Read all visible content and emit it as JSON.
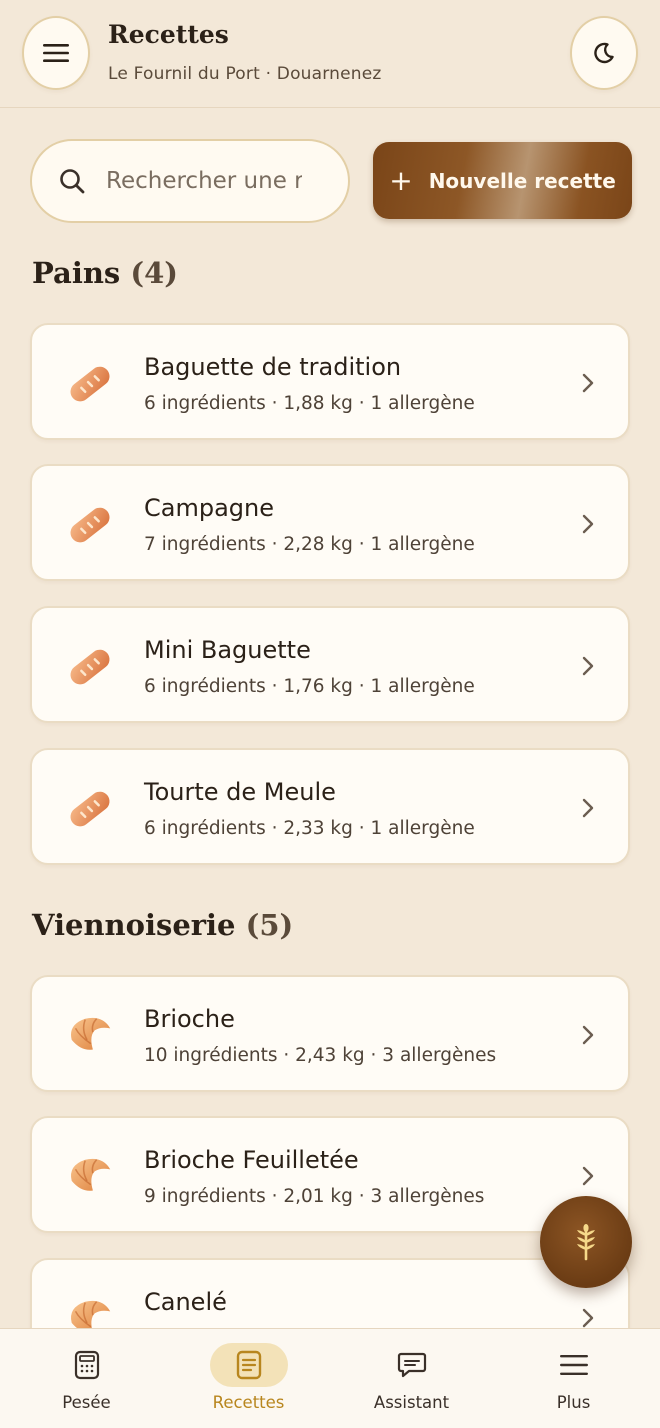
{
  "header": {
    "title": "Recettes",
    "subtitle": "Le Fournil du Port · Douarnenez"
  },
  "search": {
    "placeholder": "Rechercher une recette",
    "value": ""
  },
  "actions": {
    "new_recipe_label": "Nouvelle recette"
  },
  "sections": [
    {
      "title": "Pains",
      "count": "(4)",
      "icon": "bread-icon",
      "items": [
        {
          "name": "Baguette de tradition",
          "meta": "6 ingrédients · 1,88 kg · 1 allergène"
        },
        {
          "name": "Campagne",
          "meta": "7 ingrédients · 2,28 kg · 1 allergène"
        },
        {
          "name": "Mini Baguette",
          "meta": "6 ingrédients · 1,76 kg · 1 allergène"
        },
        {
          "name": "Tourte de Meule",
          "meta": "6 ingrédients · 2,33 kg · 1 allergène"
        }
      ]
    },
    {
      "title": "Viennoiserie",
      "count": "(5)",
      "icon": "croissant-icon",
      "items": [
        {
          "name": "Brioche",
          "meta": "10 ingrédients · 2,43 kg · 3 allergènes"
        },
        {
          "name": "Brioche Feuilletée",
          "meta": "9 ingrédients · 2,01 kg · 3 allergènes"
        },
        {
          "name": "Canelé",
          "meta": ""
        }
      ]
    }
  ],
  "tabs": [
    {
      "label": "Pesée",
      "icon": "calculator-icon",
      "active": false
    },
    {
      "label": "Recettes",
      "icon": "document-icon",
      "active": true
    },
    {
      "label": "Assistant",
      "icon": "chat-icon",
      "active": false
    },
    {
      "label": "Plus",
      "icon": "menu-icon",
      "active": false
    }
  ],
  "colors": {
    "background": "#f3e8d8",
    "accent": "#7a4518",
    "active_tab": "#b8861e",
    "card": "#fffcf6"
  }
}
